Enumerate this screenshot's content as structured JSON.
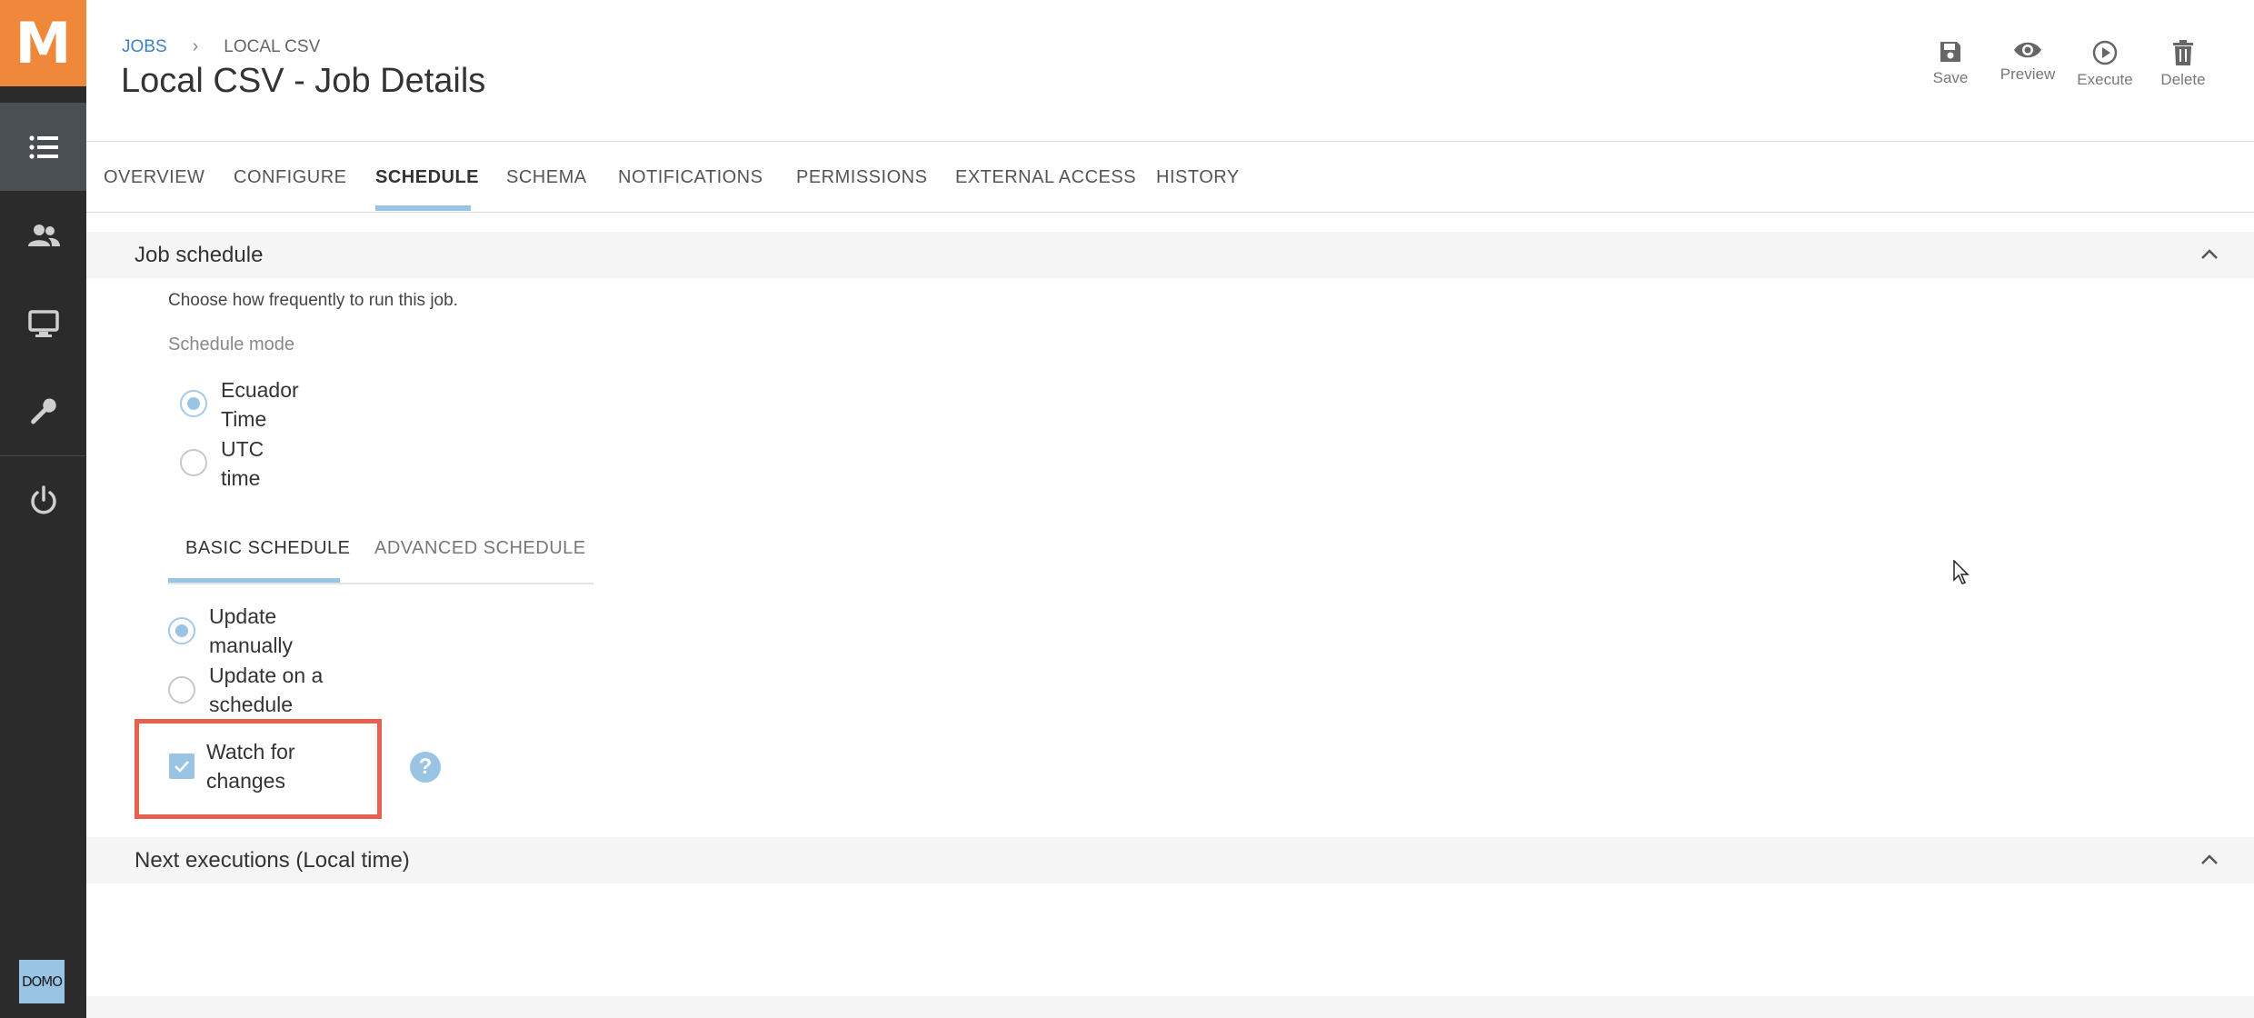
{
  "app": {
    "logo_letter": "M",
    "brand_badge": "DOMO"
  },
  "sidebar": {
    "items": [
      {
        "icon": "list-icon",
        "active": true
      },
      {
        "icon": "users-icon",
        "active": false
      },
      {
        "icon": "monitor-icon",
        "active": false
      },
      {
        "icon": "wrench-icon",
        "active": false
      },
      {
        "icon": "power-icon",
        "active": false
      }
    ]
  },
  "header": {
    "breadcrumb": {
      "root": "JOBS",
      "current": "LOCAL CSV"
    },
    "title": "Local CSV - Job Details"
  },
  "toolbar": {
    "save_label": "Save",
    "preview_label": "Preview",
    "execute_label": "Execute",
    "delete_label": "Delete"
  },
  "tabs": [
    {
      "label": "OVERVIEW"
    },
    {
      "label": "CONFIGURE"
    },
    {
      "label": "SCHEDULE",
      "active": true
    },
    {
      "label": "SCHEMA"
    },
    {
      "label": "NOTIFICATIONS"
    },
    {
      "label": "PERMISSIONS"
    },
    {
      "label": "EXTERNAL ACCESS"
    },
    {
      "label": "HISTORY"
    }
  ],
  "job_schedule": {
    "title": "Job schedule",
    "hint": "Choose how frequently to run this job.",
    "mode_label": "Schedule mode",
    "modes": [
      {
        "line1": "Ecuador",
        "line2": "Time",
        "checked": true
      },
      {
        "line1": "UTC",
        "line2": "time",
        "checked": false
      }
    ],
    "subtabs": [
      {
        "label": "BASIC SCHEDULE",
        "active": true
      },
      {
        "label": "ADVANCED SCHEDULE",
        "active": false
      }
    ],
    "update_options": [
      {
        "line1": "Update",
        "line2": "manually",
        "checked": true
      },
      {
        "line1": "Update on a",
        "line2": "schedule",
        "checked": false
      }
    ],
    "watch": {
      "line1": "Watch for",
      "line2": "changes",
      "checked": true
    },
    "help_glyph": "?"
  },
  "next_executions": {
    "title": "Next executions (Local time)"
  },
  "colors": {
    "accent": "#99c4e4",
    "brand": "#f0883c",
    "sidebar": "#2b2b2b",
    "highlight": "#e8604f",
    "link": "#3d82c7"
  }
}
